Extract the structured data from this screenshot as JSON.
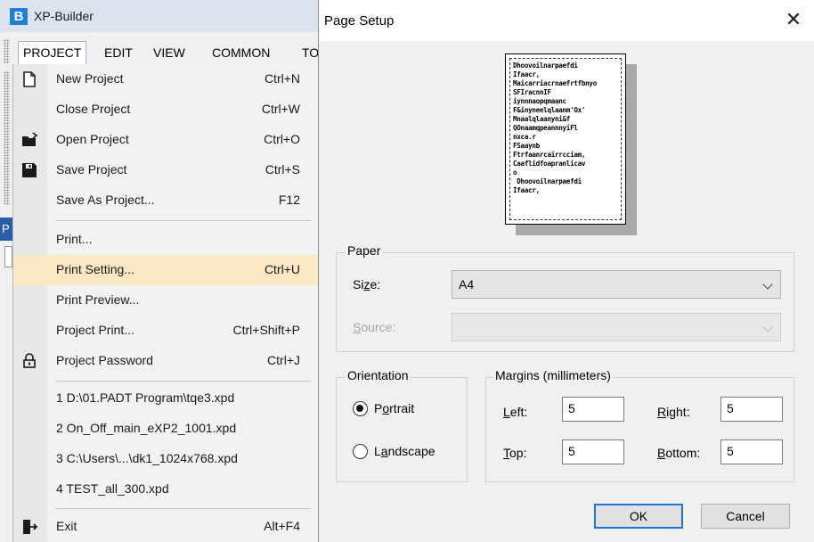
{
  "app": {
    "title": "XP-Builder",
    "logo_letter": "B",
    "menubar": [
      "PROJECT",
      "EDIT",
      "VIEW",
      "COMMON",
      "TO"
    ],
    "side_panel_letter": "P"
  },
  "project_menu": {
    "items": [
      {
        "label": "New Project",
        "shortcut": "Ctrl+N",
        "icon": "new-file-icon"
      },
      {
        "label": "Close Project",
        "shortcut": "Ctrl+W",
        "icon": ""
      },
      {
        "label": "Open Project",
        "shortcut": "Ctrl+O",
        "icon": "open-folder-icon"
      },
      {
        "label": "Save Project",
        "shortcut": "Ctrl+S",
        "icon": "floppy-disk-icon"
      },
      {
        "label": "Save As Project...",
        "shortcut": "F12",
        "icon": ""
      },
      {
        "label": "Print...",
        "shortcut": "",
        "icon": ""
      },
      {
        "label": "Print Setting...",
        "shortcut": "Ctrl+U",
        "icon": ""
      },
      {
        "label": "Print Preview...",
        "shortcut": "",
        "icon": ""
      },
      {
        "label": "Project Print...",
        "shortcut": "Ctrl+Shift+P",
        "icon": ""
      },
      {
        "label": "Project Password",
        "shortcut": "Ctrl+J",
        "icon": "padlock-icon"
      },
      {
        "label": "1 D:\\01.PADT Program\\tqe3.xpd",
        "shortcut": "",
        "icon": ""
      },
      {
        "label": "2 On_Off_main_eXP2_1001.xpd",
        "shortcut": "",
        "icon": ""
      },
      {
        "label": "3 C:\\Users\\...\\dk1_1024x768.xpd",
        "shortcut": "",
        "icon": ""
      },
      {
        "label": "4 TEST_all_300.xpd",
        "shortcut": "",
        "icon": ""
      },
      {
        "label": "Exit",
        "shortcut": "Alt+F4",
        "icon": "exit-door-icon"
      }
    ],
    "highlighted": "Print Setting..."
  },
  "page_setup": {
    "title": "Page Setup",
    "preview_text": "Dhoovoilnarpaefdi\nIfaacr,\nMaicarriacrnaefrtfbnyo\nSFIracnnIF\niynnnaopqmaanc\nF&inyneelqlaanm'Ox'\nMnaalqlaanyni&f\nQOnaamqpeannnyiFl\nnxca.r\nFSaaynb\nFtrfaanrcairrcciam,\nCaaflidfoapranlicav\no\n Dhoovoilnarpaefdi\nIfaacr,",
    "paper_group": "Paper",
    "size_label_u": "z",
    "size_label_pre": "Si",
    "size_label_post": "e:",
    "size_value": "A4",
    "source_label_u": "S",
    "source_label_post": "ource:",
    "source_value": "",
    "orientation_group": "Orientation",
    "portrait_u": "o",
    "portrait_pre": "P",
    "portrait_post": "rtrait",
    "landscape_u": "a",
    "landscape_pre": "L",
    "landscape_post": "ndscape",
    "orientation_selected": "Portrait",
    "margins_group": "Margins (millimeters)",
    "left_u": "L",
    "left_post": "eft:",
    "right_u": "R",
    "right_post": "ight:",
    "top_u": "T",
    "top_post": "op:",
    "bottom_u": "B",
    "bottom_post": "ottom:",
    "margin_left": "5",
    "margin_right": "5",
    "margin_top": "5",
    "margin_bottom": "5",
    "ok": "OK",
    "cancel": "Cancel",
    "close_glyph": "✕"
  }
}
